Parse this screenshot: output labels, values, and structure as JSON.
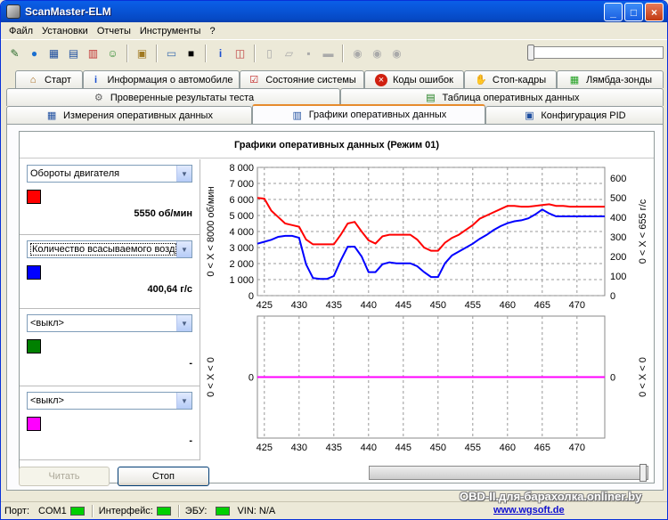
{
  "window": {
    "title": "ScanMaster-ELM"
  },
  "menu": [
    "Файл",
    "Установки",
    "Отчеты",
    "Инструменты",
    "?"
  ],
  "toolbar_icons": [
    "wizard-icon",
    "globe-icon",
    "table-icon",
    "grid-icon",
    "chart-icon",
    "person-icon",
    "clipboard-icon",
    "chat-icon",
    "terminal-icon",
    "info-icon",
    "graph-icon",
    "new-file-icon",
    "open-folder-icon",
    "save-icon",
    "print-icon",
    "play-icon",
    "pause-icon",
    "stop-icon"
  ],
  "tabs": {
    "row1": [
      {
        "label": "Старт",
        "icon": "home-icon"
      },
      {
        "label": "Информация о автомобиле",
        "icon": "info-icon"
      },
      {
        "label": "Состояние системы",
        "icon": "checklist-icon"
      },
      {
        "label": "Коды ошибок",
        "icon": "error-icon"
      },
      {
        "label": "Стоп-кадры",
        "icon": "hand-icon"
      },
      {
        "label": "Лямбда-зонды",
        "icon": "sensor-icon"
      }
    ],
    "row2": [
      {
        "label": "Проверенные результаты теста",
        "icon": "gear-icon"
      },
      {
        "label": "Таблица оперативных данных",
        "icon": "table-icon"
      }
    ],
    "row3": [
      {
        "label": "Измерения оперативных данных",
        "icon": "grid-icon"
      },
      {
        "label": "Графики оперативных данных",
        "icon": "chart-icon"
      },
      {
        "label": "Конфигурация PID",
        "icon": "config-icon"
      }
    ]
  },
  "chart_title": "Графики оперативных данных (Режим 01)",
  "sensors": [
    {
      "select": "Обороты двигателя",
      "color": "#FF0000",
      "value": "5550 об/мин"
    },
    {
      "select": "Количество всасываемого возд",
      "color": "#0000FF",
      "value": "400,64 г/с"
    },
    {
      "select": "<выкл>",
      "color": "#008000",
      "value": "-"
    },
    {
      "select": "<выкл>",
      "color": "#FF00FF",
      "value": "-"
    }
  ],
  "chart_data": [
    {
      "type": "line",
      "x_range": [
        424,
        474
      ],
      "x_ticks": [
        425,
        430,
        435,
        440,
        445,
        450,
        455,
        460,
        465,
        470
      ],
      "left_axis": {
        "label": "0 < X < 8000 об/мин",
        "range": [
          0,
          8000
        ],
        "ticks": [
          "0",
          "1 000",
          "2 000",
          "3 000",
          "4 000",
          "5 000",
          "6 000",
          "7 000",
          "8 000"
        ]
      },
      "right_axis": {
        "label": "0 < X < 655 г/с",
        "range": [
          0,
          655
        ],
        "ticks": [
          "0",
          "100",
          "200",
          "300",
          "400",
          "500",
          "600"
        ]
      },
      "grid": true,
      "series": [
        {
          "axis": "left",
          "color": "#FF0000",
          "x": [
            424,
            425,
            426,
            427,
            428,
            429,
            430,
            431,
            432,
            433,
            434,
            435,
            436,
            437,
            438,
            439,
            440,
            441,
            442,
            443,
            444,
            445,
            446,
            447,
            448,
            449,
            450,
            451,
            452,
            453,
            454,
            455,
            456,
            457,
            458,
            459,
            460,
            461,
            462,
            463,
            464,
            465,
            466,
            467,
            468,
            469,
            470,
            471,
            472,
            473,
            474
          ],
          "y": [
            6100,
            6050,
            5300,
            4900,
            4500,
            4400,
            4300,
            3500,
            3200,
            3200,
            3200,
            3200,
            3800,
            4500,
            4600,
            4000,
            3450,
            3250,
            3700,
            3800,
            3800,
            3800,
            3800,
            3500,
            3000,
            2800,
            2800,
            3300,
            3600,
            3800,
            4100,
            4400,
            4800,
            5000,
            5200,
            5400,
            5600,
            5600,
            5550,
            5550,
            5600,
            5650,
            5700,
            5600,
            5600,
            5550,
            5550,
            5550,
            5550,
            5550,
            5550
          ]
        },
        {
          "axis": "right",
          "color": "#0000FF",
          "x": [
            424,
            425,
            426,
            427,
            428,
            429,
            430,
            431,
            432,
            433,
            434,
            435,
            436,
            437,
            438,
            439,
            440,
            441,
            442,
            443,
            444,
            445,
            446,
            447,
            448,
            449,
            450,
            451,
            452,
            453,
            454,
            455,
            456,
            457,
            458,
            459,
            460,
            461,
            462,
            463,
            464,
            465,
            466,
            467,
            468,
            469,
            470,
            471,
            472,
            473,
            474
          ],
          "y": [
            265,
            275,
            285,
            300,
            305,
            305,
            295,
            160,
            90,
            85,
            85,
            100,
            180,
            250,
            250,
            200,
            120,
            120,
            160,
            170,
            165,
            165,
            165,
            150,
            120,
            95,
            95,
            165,
            205,
            225,
            245,
            265,
            290,
            310,
            335,
            355,
            370,
            380,
            385,
            395,
            415,
            440,
            420,
            405,
            405,
            405,
            405,
            405,
            405,
            405,
            405
          ]
        }
      ]
    },
    {
      "type": "line",
      "x_range": [
        424,
        474
      ],
      "x_ticks": [
        425,
        430,
        435,
        440,
        445,
        450,
        455,
        460,
        465,
        470
      ],
      "left_axis": {
        "label": "0 < X < 0",
        "ticks": [
          "0"
        ]
      },
      "right_axis": {
        "label": "0 < X < 0",
        "ticks": [
          "0"
        ]
      },
      "grid": true,
      "series": [
        {
          "axis": "left",
          "color": "#FF00FF",
          "x": [
            424,
            474
          ],
          "y": [
            0,
            0
          ]
        }
      ]
    }
  ],
  "buttons": {
    "read": "Читать",
    "stop": "Стоп"
  },
  "status": {
    "port_label": "Порт:",
    "port_value": "COM1",
    "interface_label": "Интерфейс:",
    "ecu_label": "ЭБУ:",
    "vin": "VIN: N/A"
  },
  "watermark": {
    "line1": "OBD-II.для-барахолка.onliner.by",
    "line2": "www.wgsoft.de"
  }
}
